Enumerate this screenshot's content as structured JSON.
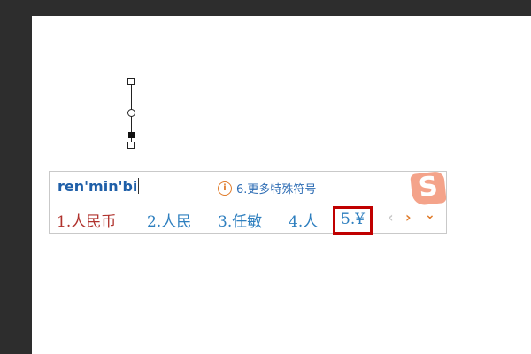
{
  "ime": {
    "composition": "ren'min'bi",
    "hint": "6.更多特殊符号",
    "logo_letter": "S",
    "candidates": [
      {
        "label": "1.人民币"
      },
      {
        "label": "2.人民"
      },
      {
        "label": "3.任敏"
      },
      {
        "label": "4.人"
      },
      {
        "label": "5.¥"
      }
    ],
    "nav": {
      "prev": "‹",
      "next": "›",
      "more": "⌄"
    },
    "colors": {
      "pinyin": "#1f5fa8",
      "first_candidate": "#b0322d",
      "candidate": "#2e7fbf",
      "selection_box": "#c00000",
      "accent": "#e07b2a"
    }
  }
}
